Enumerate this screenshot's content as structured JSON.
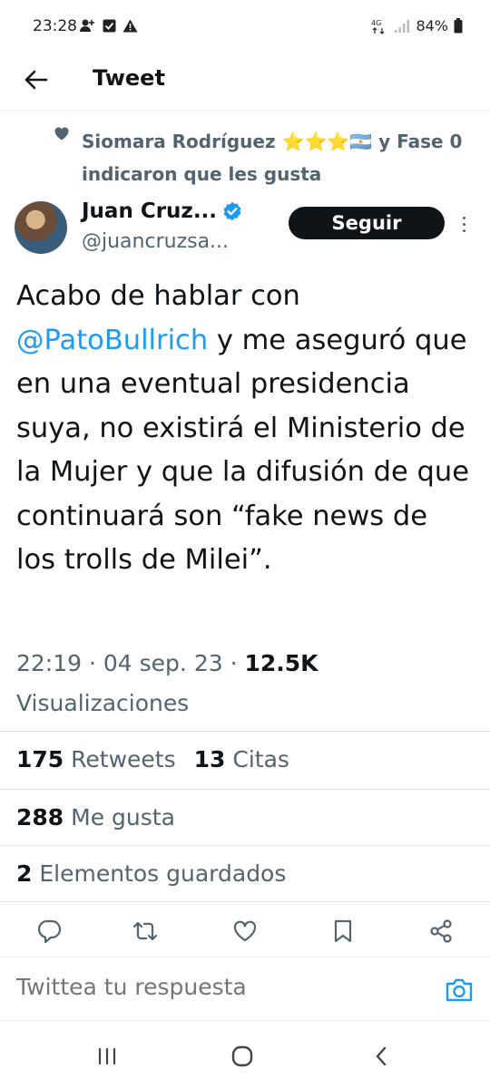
{
  "status_bar": {
    "time": "23:28",
    "network": "4G",
    "battery": "84%"
  },
  "header": {
    "title": "Tweet"
  },
  "social_context": {
    "text": "Siomara Rodríguez ⭐⭐⭐🇦🇷 y Fase 0 indicaron que les gusta"
  },
  "author": {
    "name": "Juan Cruz...",
    "handle": "@juancruzsa...",
    "follow_label": "Seguir"
  },
  "tweet": {
    "text_before": "Acabo de hablar con ",
    "mention": "@PatoBullrich",
    "text_after": " y me aseguró que en una eventual presidencia suya, no existirá el Ministerio de la Mujer y que la difusión de que continuará son “fake news de los trolls de Milei”."
  },
  "meta": {
    "time": "22:19",
    "date": "04 sep. 23",
    "views_count": "12.5K",
    "views_label": "Visualizaciones"
  },
  "stats": {
    "retweets_count": "175",
    "retweets_label": "Retweets",
    "quotes_count": "13",
    "quotes_label": "Citas",
    "likes_count": "288",
    "likes_label": "Me gusta",
    "bookmarks_count": "2",
    "bookmarks_label": "Elementos guardados"
  },
  "reply": {
    "placeholder": "Twittea tu respuesta"
  },
  "colors": {
    "accent": "#1d9bf0",
    "text_primary": "#0f1419",
    "text_secondary": "#536471"
  }
}
